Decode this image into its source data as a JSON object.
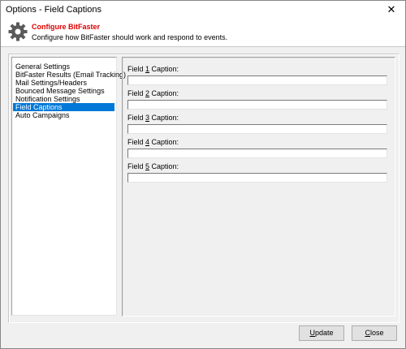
{
  "window": {
    "title": "Options - Field Captions",
    "close_glyph": "✕"
  },
  "header": {
    "icon": "gear-icon",
    "title": "Configure BitFaster",
    "subtitle": "Configure how BitFaster should work and respond to events.",
    "title_color": "#e00000"
  },
  "sidebar": {
    "items": [
      {
        "label": "General Settings",
        "selected": false
      },
      {
        "label": "BitFaster Results (Email Tracking)",
        "selected": false
      },
      {
        "label": "Mail Settings/Headers",
        "selected": false
      },
      {
        "label": "Bounced Message Settings",
        "selected": false
      },
      {
        "label": "Notification Settings",
        "selected": false
      },
      {
        "label": "Field Captions",
        "selected": true
      },
      {
        "label": "Auto Campaigns",
        "selected": false
      }
    ],
    "selected_color": "#0078d7"
  },
  "fields": [
    {
      "pre": "Field ",
      "key": "1",
      "post": " Caption:",
      "value": ""
    },
    {
      "pre": "Field ",
      "key": "2",
      "post": " Caption:",
      "value": ""
    },
    {
      "pre": "Field ",
      "key": "3",
      "post": " Caption:",
      "value": ""
    },
    {
      "pre": "Field ",
      "key": "4",
      "post": " Caption:",
      "value": ""
    },
    {
      "pre": "Field ",
      "key": "5",
      "post": " Caption:",
      "value": ""
    }
  ],
  "buttons": {
    "update": {
      "key": "U",
      "rest": "pdate"
    },
    "close": {
      "key": "C",
      "rest": "lose"
    }
  }
}
